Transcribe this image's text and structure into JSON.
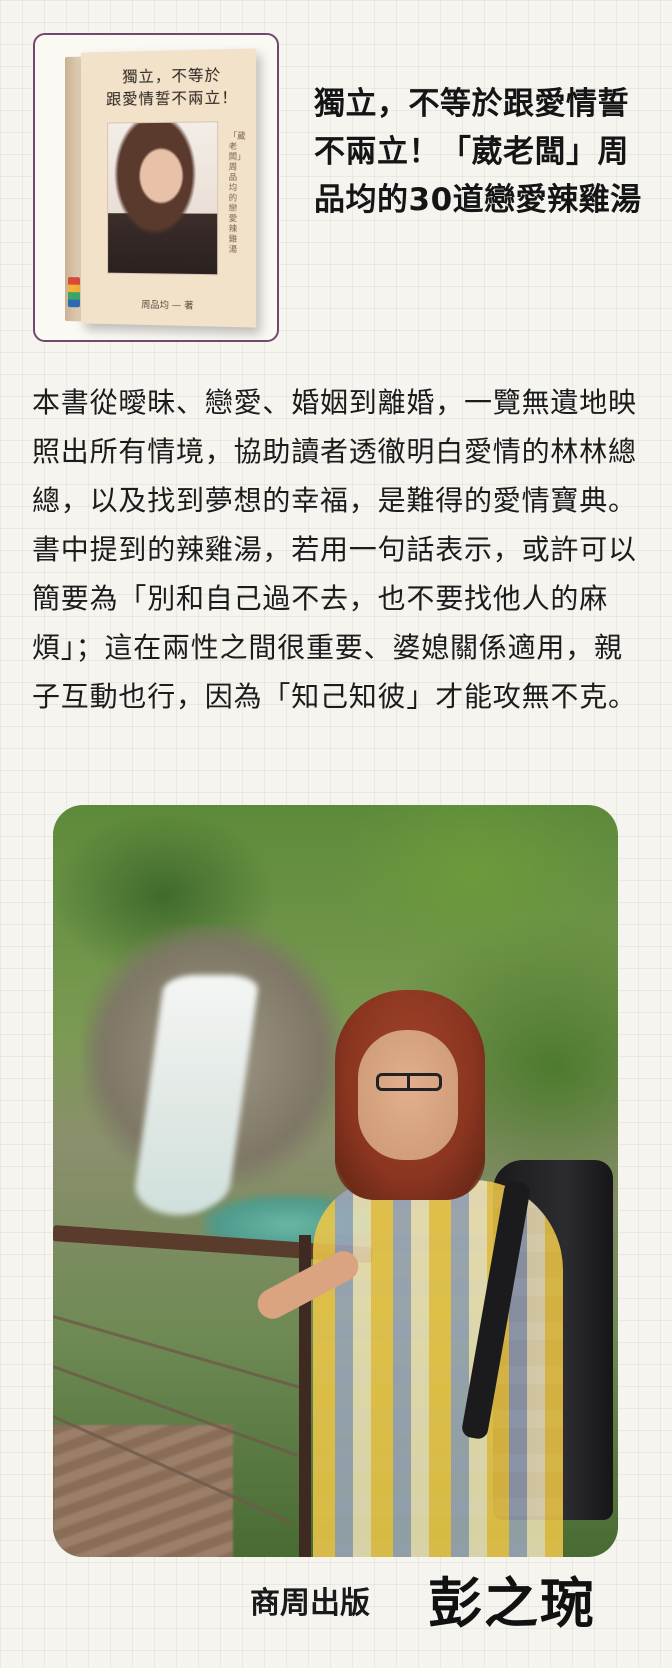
{
  "book": {
    "cover_title_line1": "獨立，不等於",
    "cover_title_line2": "跟愛情誓不兩立！",
    "cover_side_text": "「葳老闆」周品均的戀愛辣雞湯",
    "cover_author": "周品均 — 著"
  },
  "headline": "獨立，不等於跟愛情誓不兩立！「葳老闆」周品均的30道戀愛辣雞湯",
  "body": "本書從曖昧、戀愛、婚姻到離婚，一覽無遺地映照出所有情境，協助讀者透徹明白愛情的林林總總，以及找到夢想的幸福，是難得的愛情寶典。書中提到的辣雞湯，若用一句話表示，或許可以簡要為「別和自己過不去，也不要找他人的麻煩」；這在兩性之間很重要、婆媳關係適用，親子互動也行，因為「知己知彼」才能攻無不克。",
  "footer": {
    "publisher": "商周出版",
    "reviewer_name": "彭之琬"
  }
}
